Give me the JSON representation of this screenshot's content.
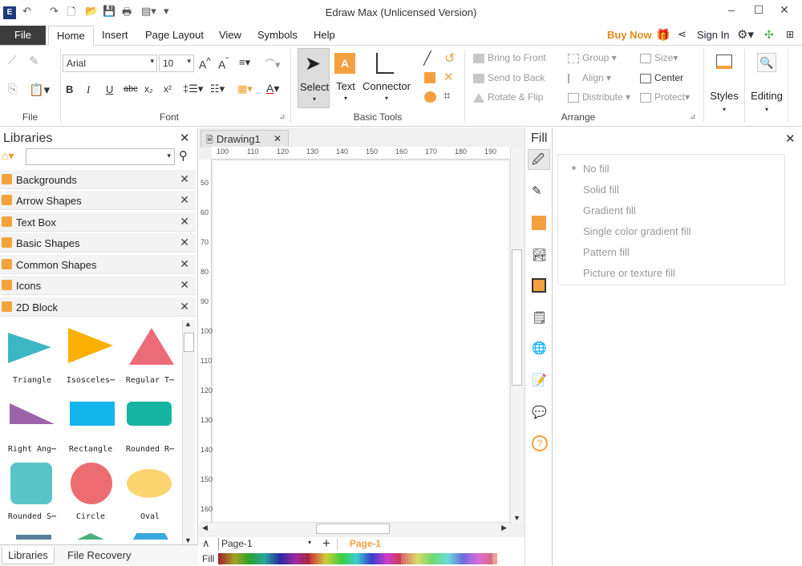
{
  "app": {
    "title": "Edraw Max (Unlicensed Version)"
  },
  "menu": {
    "file": "File",
    "tabs": [
      "Home",
      "Insert",
      "Page Layout",
      "View",
      "Symbols",
      "Help"
    ],
    "buy_now": "Buy Now",
    "sign_in": "Sign In"
  },
  "ribbon": {
    "groups": {
      "file": "File",
      "font": "Font",
      "basic_tools": "Basic Tools",
      "arrange": "Arrange"
    },
    "font_name": "Arial",
    "font_size": "10",
    "tools": {
      "select": "Select",
      "text": "Text",
      "connector": "Connector"
    },
    "arrange": {
      "bring_to_front": "Bring to Front",
      "send_to_back": "Send to Back",
      "rotate_flip": "Rotate & Flip",
      "group": "Group",
      "align": "Align",
      "distribute": "Distribute",
      "size": "Size",
      "center": "Center",
      "protect": "Protect"
    },
    "styles": "Styles",
    "editing": "Editing"
  },
  "libraries": {
    "title": "Libraries",
    "items": [
      "Backgrounds",
      "Arrow Shapes",
      "Text Box",
      "Basic Shapes",
      "Common Shapes",
      "Icons",
      "2D Block"
    ],
    "shapes": [
      "Triangle",
      "Isosceles⋯",
      "Regular T⋯",
      "Right Ang⋯",
      "Rectangle",
      "Rounded R⋯",
      "Rounded S⋯",
      "Circle",
      "Oval"
    ],
    "bottom_tabs": [
      "Libraries",
      "File Recovery"
    ]
  },
  "canvas": {
    "doc_tab": "Drawing1",
    "ruler_h": [
      "100",
      "110",
      "120",
      "130",
      "140",
      "150",
      "160",
      "170",
      "180",
      "190"
    ],
    "ruler_v": [
      "50",
      "60",
      "70",
      "80",
      "90",
      "100",
      "110",
      "120",
      "130",
      "140",
      "150",
      "160"
    ],
    "page_select": "Page-1",
    "page_tab": "Page-1",
    "fill_label": "Fill"
  },
  "fill_panel": {
    "title": "Fill",
    "options": [
      "No fill",
      "Solid fill",
      "Gradient fill",
      "Single color gradient fill",
      "Pattern fill",
      "Picture or texture fill"
    ]
  },
  "colors": {
    "accent_orange": "#f5a040",
    "shape_teal": "#3cb8c4",
    "shape_orange": "#f9b000",
    "shape_red": "#ec6b78",
    "shape_purple": "#9c64a8",
    "shape_blue": "#14b4ec",
    "shape_green": "#14b4a0",
    "shape_teal2": "#58c4c8",
    "shape_coral": "#ec6c70",
    "shape_yellow": "#fcd470"
  }
}
